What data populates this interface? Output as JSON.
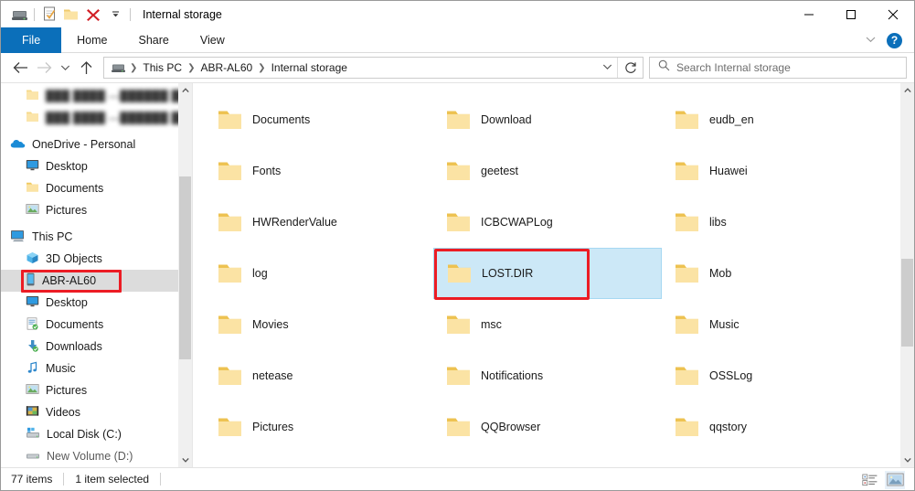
{
  "window": {
    "title": "Internal storage",
    "quick_access": [
      {
        "name": "this-pc-icon",
        "label": "This PC"
      },
      {
        "name": "properties-icon",
        "label": "Properties"
      },
      {
        "name": "new-folder-icon",
        "label": "New folder"
      },
      {
        "name": "delete-icon",
        "label": "Delete"
      },
      {
        "name": "chevron-down-icon",
        "label": "Customize Quick Access Toolbar"
      }
    ],
    "controls": {
      "minimize": "Minimize",
      "maximize": "Maximize",
      "close": "Close"
    }
  },
  "ribbon": {
    "tabs": [
      {
        "label": "File",
        "active": true
      },
      {
        "label": "Home",
        "active": false
      },
      {
        "label": "Share",
        "active": false
      },
      {
        "label": "View",
        "active": false
      }
    ],
    "collapse_label": "Minimize the Ribbon",
    "help_label": "?"
  },
  "navbar": {
    "back": "Back",
    "forward": "Forward",
    "recent": "Recent locations",
    "up": "Up",
    "breadcrumb": [
      "This PC",
      "ABR-AL60",
      "Internal storage"
    ],
    "dropdown": "Previous locations",
    "refresh": "Refresh",
    "search": {
      "placeholder": "Search Internal storage",
      "value": ""
    }
  },
  "sidebar": {
    "items": [
      {
        "label": "███ ████ —██████ ██████",
        "icon": "folder-icon",
        "indent": 1,
        "blurred": true,
        "selected": false
      },
      {
        "label": "███ ████ —██████ ████",
        "icon": "folder-icon",
        "indent": 1,
        "blurred": true,
        "selected": false
      },
      {
        "label": "OneDrive - Personal",
        "icon": "onedrive-icon",
        "indent": 0,
        "blurred": false,
        "selected": false
      },
      {
        "label": "Desktop",
        "icon": "desktop-icon",
        "indent": 1,
        "blurred": false,
        "selected": false
      },
      {
        "label": "Documents",
        "icon": "folder-icon",
        "indent": 1,
        "blurred": false,
        "selected": false
      },
      {
        "label": "Pictures",
        "icon": "pictures-icon",
        "indent": 1,
        "blurred": false,
        "selected": false
      },
      {
        "label": "This PC",
        "icon": "this-pc-icon",
        "indent": 0,
        "blurred": false,
        "selected": false
      },
      {
        "label": "3D Objects",
        "icon": "3d-objects-icon",
        "indent": 1,
        "blurred": false,
        "selected": false
      },
      {
        "label": "ABR-AL60",
        "icon": "phone-icon",
        "indent": 1,
        "blurred": false,
        "selected": true
      },
      {
        "label": "Desktop",
        "icon": "desktop-icon",
        "indent": 1,
        "blurred": false,
        "selected": false
      },
      {
        "label": "Documents",
        "icon": "documents-icon",
        "indent": 1,
        "blurred": false,
        "selected": false
      },
      {
        "label": "Downloads",
        "icon": "downloads-icon",
        "indent": 1,
        "blurred": false,
        "selected": false
      },
      {
        "label": "Music",
        "icon": "music-icon",
        "indent": 1,
        "blurred": false,
        "selected": false
      },
      {
        "label": "Pictures",
        "icon": "pictures-icon",
        "indent": 1,
        "blurred": false,
        "selected": false
      },
      {
        "label": "Videos",
        "icon": "videos-icon",
        "indent": 1,
        "blurred": false,
        "selected": false
      },
      {
        "label": "Local Disk (C:)",
        "icon": "disk-icon",
        "indent": 1,
        "blurred": false,
        "selected": false
      },
      {
        "label": "New Volume (D:)",
        "icon": "disk-icon",
        "indent": 1,
        "blurred": false,
        "selected": false
      }
    ]
  },
  "files": {
    "items": [
      {
        "name": "",
        "partial": true,
        "selected": false
      },
      {
        "name": "",
        "partial": true,
        "selected": false
      },
      {
        "name": "",
        "partial": true,
        "selected": false
      },
      {
        "name": "Documents",
        "partial": false,
        "selected": false
      },
      {
        "name": "Download",
        "partial": false,
        "selected": false
      },
      {
        "name": "eudb_en",
        "partial": false,
        "selected": false
      },
      {
        "name": "Fonts",
        "partial": false,
        "selected": false
      },
      {
        "name": "geetest",
        "partial": false,
        "selected": false
      },
      {
        "name": "Huawei",
        "partial": false,
        "selected": false
      },
      {
        "name": "HWRenderValue",
        "partial": false,
        "selected": false
      },
      {
        "name": "ICBCWAPLog",
        "partial": false,
        "selected": false
      },
      {
        "name": "libs",
        "partial": false,
        "selected": false
      },
      {
        "name": "log",
        "partial": false,
        "selected": false
      },
      {
        "name": "LOST.DIR",
        "partial": false,
        "selected": true
      },
      {
        "name": "Mob",
        "partial": false,
        "selected": false
      },
      {
        "name": "Movies",
        "partial": false,
        "selected": false
      },
      {
        "name": "msc",
        "partial": false,
        "selected": false
      },
      {
        "name": "Music",
        "partial": false,
        "selected": false
      },
      {
        "name": "netease",
        "partial": false,
        "selected": false
      },
      {
        "name": "Notifications",
        "partial": false,
        "selected": false
      },
      {
        "name": "OSSLog",
        "partial": false,
        "selected": false
      },
      {
        "name": "Pictures",
        "partial": false,
        "selected": false
      },
      {
        "name": "QQBrowser",
        "partial": false,
        "selected": false
      },
      {
        "name": "qqstory",
        "partial": false,
        "selected": false
      }
    ]
  },
  "statusbar": {
    "item_count": "77 items",
    "selection": "1 item selected",
    "details_view_label": "Details view",
    "large_icons_view_label": "Large icons view"
  },
  "annotations": {
    "highlight_color": "#ec1c24",
    "targets": [
      "ABR-AL60",
      "LOST.DIR"
    ]
  },
  "colors": {
    "accent": "#0b6fba",
    "selection_fill": "#cce8f7",
    "selection_border": "#a6d8f2",
    "sidebar_selected": "#dcdcdc",
    "folder": "#fbd989",
    "annotation": "#ec1c24"
  }
}
